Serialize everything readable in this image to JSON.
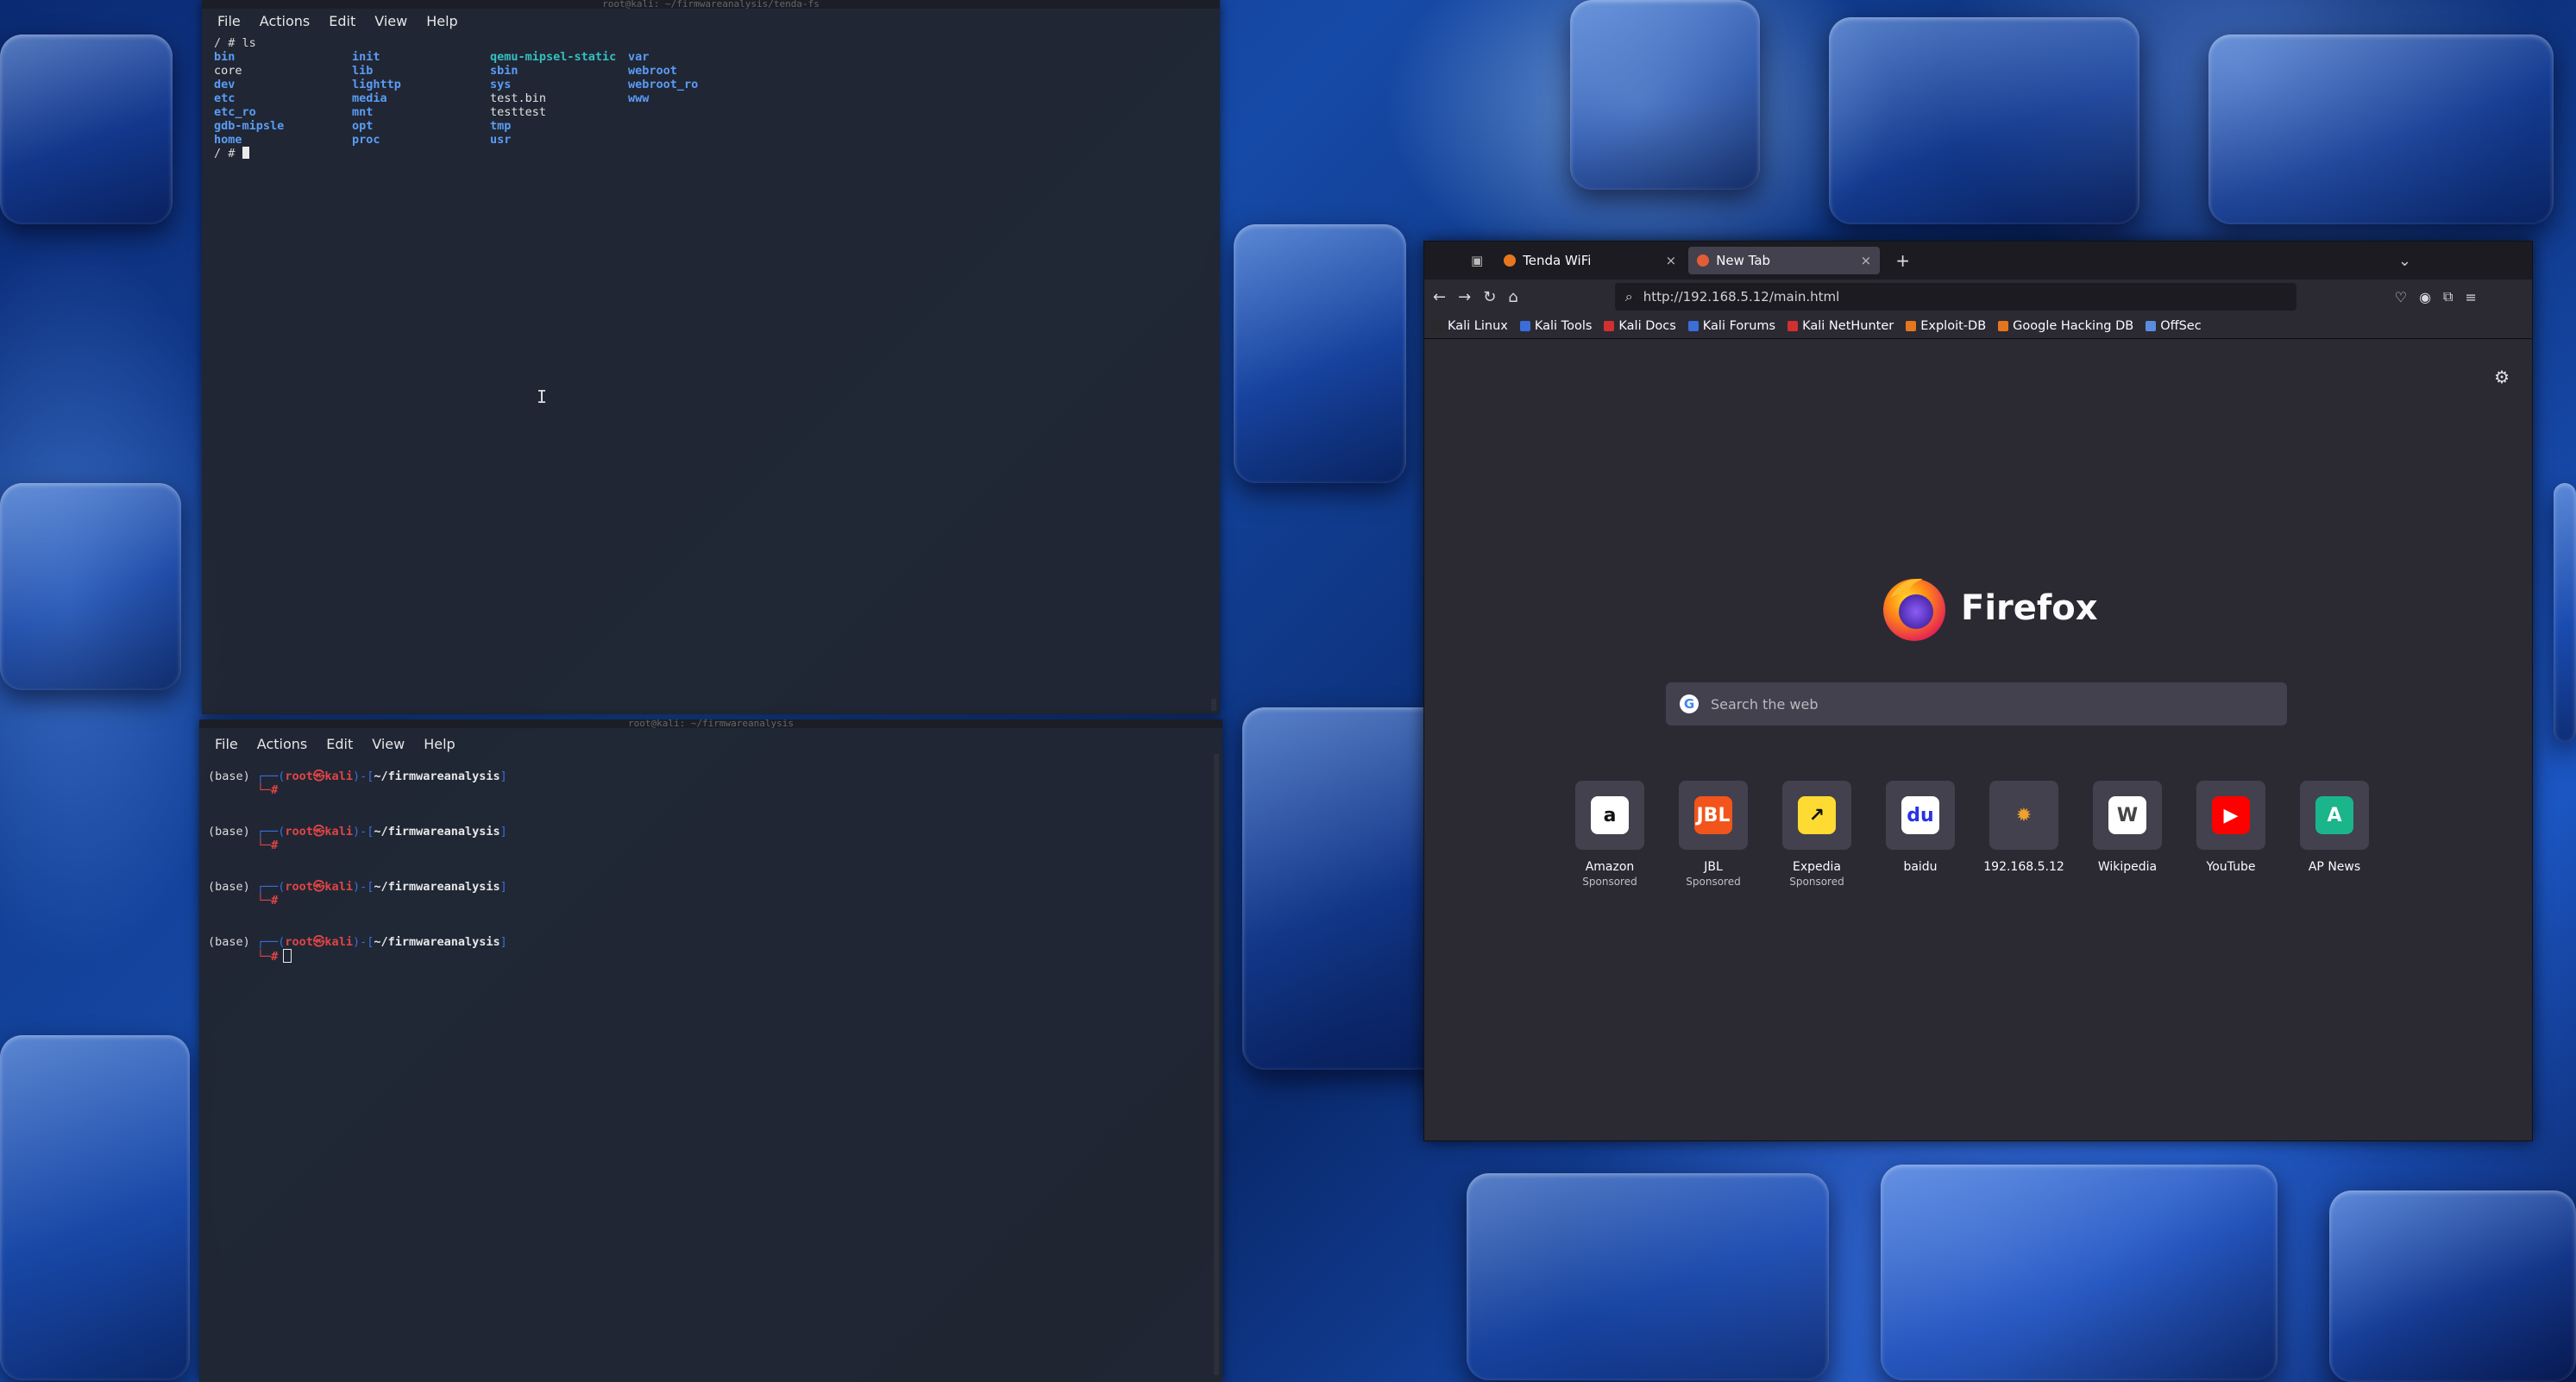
{
  "terminal_top": {
    "title": "root@kali: ~/firmwareanalysis/tenda-fs",
    "menu": [
      "File",
      "Actions",
      "Edit",
      "View",
      "Help"
    ],
    "command": "/ # ls",
    "ls_columns": [
      [
        {
          "t": "bin",
          "k": "dir"
        },
        {
          "t": "core",
          "k": "file"
        },
        {
          "t": "dev",
          "k": "dir"
        },
        {
          "t": "etc",
          "k": "dir"
        },
        {
          "t": "etc_ro",
          "k": "dir"
        },
        {
          "t": "gdb-mipsle",
          "k": "dir"
        },
        {
          "t": "home",
          "k": "dir"
        }
      ],
      [
        {
          "t": "init",
          "k": "dir"
        },
        {
          "t": "lib",
          "k": "dir"
        },
        {
          "t": "lighttp",
          "k": "dir"
        },
        {
          "t": "media",
          "k": "dir"
        },
        {
          "t": "mnt",
          "k": "dir"
        },
        {
          "t": "opt",
          "k": "dir"
        },
        {
          "t": "proc",
          "k": "dir"
        }
      ],
      [
        {
          "t": "qemu-mipsel-static",
          "k": "exe"
        },
        {
          "t": "sbin",
          "k": "dir"
        },
        {
          "t": "sys",
          "k": "dir"
        },
        {
          "t": "test.bin",
          "k": "file"
        },
        {
          "t": "testtest",
          "k": "file"
        },
        {
          "t": "tmp",
          "k": "dir"
        },
        {
          "t": "usr",
          "k": "dir"
        }
      ],
      [
        {
          "t": "var",
          "k": "dir"
        },
        {
          "t": "webroot",
          "k": "dir"
        },
        {
          "t": "webroot_ro",
          "k": "dir"
        },
        {
          "t": "www",
          "k": "dir"
        }
      ]
    ],
    "prompt": "/ # "
  },
  "terminal_bottom": {
    "title": "root@kali: ~/firmwareanalysis",
    "menu": [
      "File",
      "Actions",
      "Edit",
      "View",
      "Help"
    ],
    "prompts": [
      {
        "env": "(base) ",
        "frame_open": "┌──(",
        "user": "root㉿kali",
        "frame_mid": ")-[",
        "path": "~/firmwareanalysis",
        "frame_close": "]",
        "line2": "└─#"
      },
      {
        "env": "(base) ",
        "frame_open": "┌──(",
        "user": "root㉿kali",
        "frame_mid": ")-[",
        "path": "~/firmwareanalysis",
        "frame_close": "]",
        "line2": "└─#"
      },
      {
        "env": "(base) ",
        "frame_open": "┌──(",
        "user": "root㉿kali",
        "frame_mid": ")-[",
        "path": "~/firmwareanalysis",
        "frame_close": "]",
        "line2": "└─#"
      },
      {
        "env": "(base) ",
        "frame_open": "┌──(",
        "user": "root㉿kali",
        "frame_mid": ")-[",
        "path": "~/firmwareanalysis",
        "frame_close": "]",
        "line2": "└─#"
      }
    ]
  },
  "firefox": {
    "tabs": [
      {
        "title": "Tenda WiFi",
        "close": "×",
        "active": false,
        "favicon_color": "#e8761e"
      },
      {
        "title": "New Tab",
        "close": "×",
        "active": true,
        "favicon_color": "#e25d35"
      }
    ],
    "new_tab_symbol": "+",
    "tab_list_symbol": "⌄",
    "url": "http://192.168.5.12/main.html",
    "bookmarks": [
      {
        "label": "Kali Linux",
        "color": "#2a2a2a"
      },
      {
        "label": "Kali Tools",
        "color": "#3a6ed8"
      },
      {
        "label": "Kali Docs",
        "color": "#d23030"
      },
      {
        "label": "Kali Forums",
        "color": "#3a6ed8"
      },
      {
        "label": "Kali NetHunter",
        "color": "#d23030"
      },
      {
        "label": "Exploit-DB",
        "color": "#e6761e"
      },
      {
        "label": "Google Hacking DB",
        "color": "#e6761e"
      },
      {
        "label": "OffSec",
        "color": "#5a8de0"
      }
    ],
    "brand": "Firefox",
    "search_placeholder": "Search the web",
    "shortcuts": [
      {
        "name": "Amazon",
        "sponsored": "Sponsored",
        "glyph": "a",
        "bg": "#ffffff",
        "fg": "#111111"
      },
      {
        "name": "JBL",
        "sponsored": "Sponsored",
        "glyph": "JBL",
        "bg": "#f2541b",
        "fg": "#ffffff"
      },
      {
        "name": "Expedia",
        "sponsored": "Sponsored",
        "glyph": "↗",
        "bg": "#fddb32",
        "fg": "#111111"
      },
      {
        "name": "baidu",
        "sponsored": "",
        "glyph": "du",
        "bg": "#ffffff",
        "fg": "#2932e1"
      },
      {
        "name": "192.168.5.12",
        "sponsored": "",
        "glyph": "✹",
        "bg": "#42414d",
        "fg": "#f0a030"
      },
      {
        "name": "Wikipedia",
        "sponsored": "",
        "glyph": "W",
        "bg": "#ffffff",
        "fg": "#444444"
      },
      {
        "name": "YouTube",
        "sponsored": "",
        "glyph": "▶",
        "bg": "#ff0000",
        "fg": "#ffffff"
      },
      {
        "name": "AP News",
        "sponsored": "",
        "glyph": "A",
        "bg": "#1bb58c",
        "fg": "#ffffff"
      }
    ]
  }
}
